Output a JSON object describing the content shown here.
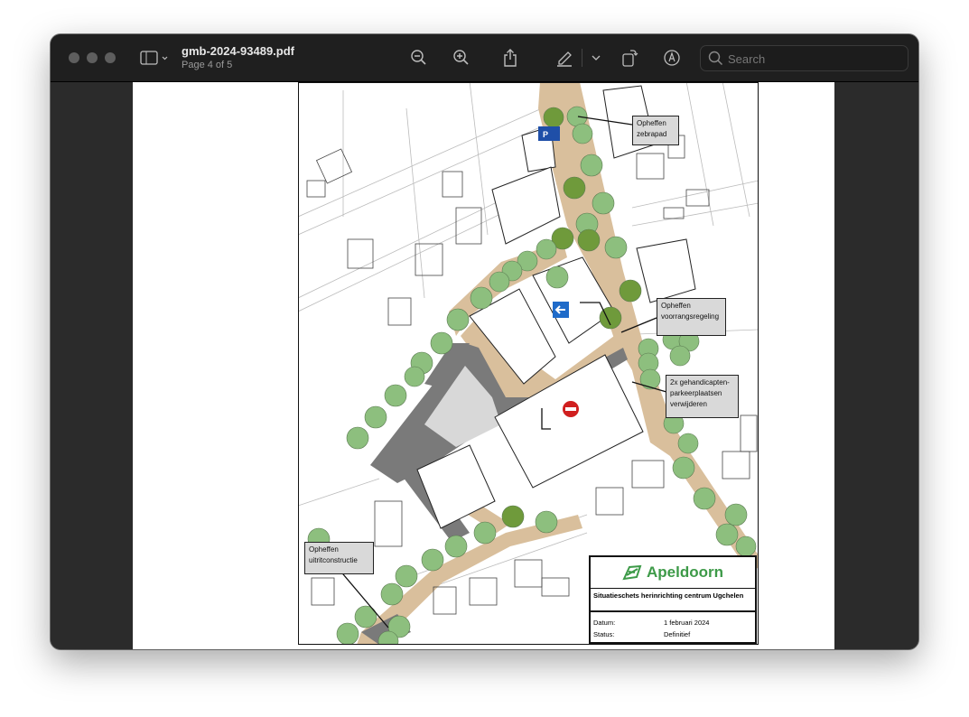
{
  "window": {
    "title": "gmb-2024-93489.pdf",
    "page_indicator": "Page 4 of 5"
  },
  "toolbar": {
    "search_placeholder": "Search",
    "icons": [
      "sidebar-icon",
      "zoom-out-icon",
      "zoom-in-icon",
      "share-icon",
      "markup-pen-icon",
      "rotate-icon",
      "annotate-icon",
      "search-icon"
    ]
  },
  "map": {
    "callouts": [
      {
        "lines": [
          "Opheffen",
          "zebrapad"
        ]
      },
      {
        "lines": [
          "Opheffen",
          "voorrangsregeling"
        ]
      },
      {
        "lines": [
          "2x gehandicapten-",
          "parkeerplaatsen",
          "verwijderen"
        ]
      },
      {
        "lines": [
          "Opheffen",
          "uitritconstructie"
        ]
      }
    ],
    "title_block": {
      "logo": "Apeldoorn",
      "subtitle": "Situatieschets herinrichting centrum Ugchelen",
      "date_label": "Datum:",
      "date_value": "1 februari 2024",
      "status_label": "Status:",
      "status_value": "Definitief"
    },
    "colors": {
      "road": "#d9bf9c",
      "parking": "#7a7a7a",
      "tree": "#8dbf7e",
      "tree_dark": "#6f9a3b",
      "logo": "#3d9a48"
    }
  }
}
